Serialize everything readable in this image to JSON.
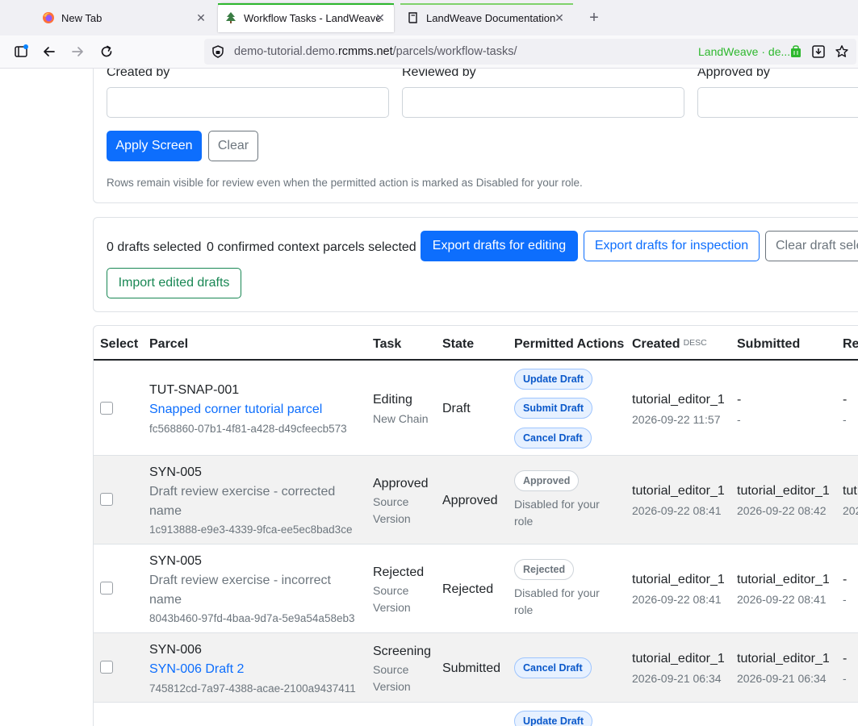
{
  "browser": {
    "tabs": [
      {
        "title": "New Tab",
        "active": false
      },
      {
        "title": "Workflow Tasks - LandWeave",
        "active": true
      },
      {
        "title": "LandWeave Documentation",
        "active": false
      }
    ],
    "url_prefix": "demo-tutorial.demo.",
    "url_domain": "rcmms.net",
    "url_path": "/parcels/workflow-tasks/",
    "extension_label": "LandWeave · de...",
    "accent_colors": {
      "active_tab": "#2eb82e",
      "docs_tab": "#7fd16b"
    }
  },
  "filters": {
    "created_by_label": "Created by",
    "reviewed_by_label": "Reviewed by",
    "approved_by_label": "Approved by",
    "apply_label": "Apply Screen",
    "clear_label": "Clear",
    "note": "Rows remain visible for review even when the permitted action is marked as Disabled for your role."
  },
  "selection": {
    "drafts_selected": "0 drafts selected",
    "context_selected": "0 confirmed context parcels selected",
    "export_editing_label": "Export drafts for editing",
    "export_inspection_label": "Export drafts for inspection",
    "clear_selection_label": "Clear draft sele",
    "import_label": "Import edited drafts"
  },
  "table": {
    "headers": {
      "select": "Select",
      "parcel": "Parcel",
      "task": "Task",
      "state": "State",
      "actions": "Permitted Actions",
      "created": "Created",
      "created_sort": "DESC",
      "submitted": "Submitted",
      "reviewed": "Re"
    },
    "rows": [
      {
        "code": "TUT-SNAP-001",
        "name_lines": [
          "Snapped corner tutorial parcel"
        ],
        "name_is_link": true,
        "uuid": "fc568860-07b1-4f81-a428-d49cfeecb573",
        "task": "Editing",
        "task_sub": [
          "New Chain"
        ],
        "state": "Draft",
        "actions": [
          "Update Draft",
          "Submit Draft",
          "Cancel Draft"
        ],
        "created_by": "tutorial_editor_1",
        "created_at": "2026-09-22 11:57",
        "submitted_by": "-",
        "submitted_at": "-",
        "reviewed_by": "-",
        "reviewed_at": "-"
      },
      {
        "code": "SYN-005",
        "name_lines": [
          "Draft review exercise - corrected",
          "name"
        ],
        "name_is_link": false,
        "uuid": "1c913888-e9e3-4339-9fca-ee5ec8bad3ce",
        "task": "Approved",
        "task_sub": [
          "Source",
          "Version"
        ],
        "state": "Approved",
        "state_pill": "Approved",
        "disabled_note": [
          "Disabled for your",
          "role"
        ],
        "created_by": "tutorial_editor_1",
        "created_at": "2026-09-22 08:41",
        "submitted_by": "tutorial_editor_1",
        "submitted_at": "2026-09-22 08:42",
        "reviewed_by": "tut",
        "reviewed_at": "202"
      },
      {
        "code": "SYN-005",
        "name_lines": [
          "Draft review exercise - incorrect",
          "name"
        ],
        "name_is_link": false,
        "uuid": "8043b460-97fd-4baa-9d7a-5e9a54a58eb3",
        "task": "Rejected",
        "task_sub": [
          "Source",
          "Version"
        ],
        "state": "Rejected",
        "state_pill": "Rejected",
        "disabled_note": [
          "Disabled for your",
          "role"
        ],
        "created_by": "tutorial_editor_1",
        "created_at": "2026-09-22 08:41",
        "submitted_by": "tutorial_editor_1",
        "submitted_at": "2026-09-22 08:41",
        "reviewed_by": "-",
        "reviewed_at": "-"
      },
      {
        "code": "SYN-006",
        "name_lines": [
          "SYN-006 Draft 2"
        ],
        "name_is_link": true,
        "uuid": "745812cd-7a97-4388-acae-2100a9437411",
        "task": "Screening",
        "task_sub": [
          "Source",
          "Version"
        ],
        "state": "Submitted",
        "actions": [
          "Cancel Draft"
        ],
        "created_by": "tutorial_editor_1",
        "created_at": "2026-09-21 06:34",
        "submitted_by": "tutorial_editor_1",
        "submitted_at": "2026-09-21 06:34",
        "reviewed_by": "-",
        "reviewed_at": "-"
      },
      {
        "actions": [
          "Update Draft"
        ]
      }
    ]
  }
}
